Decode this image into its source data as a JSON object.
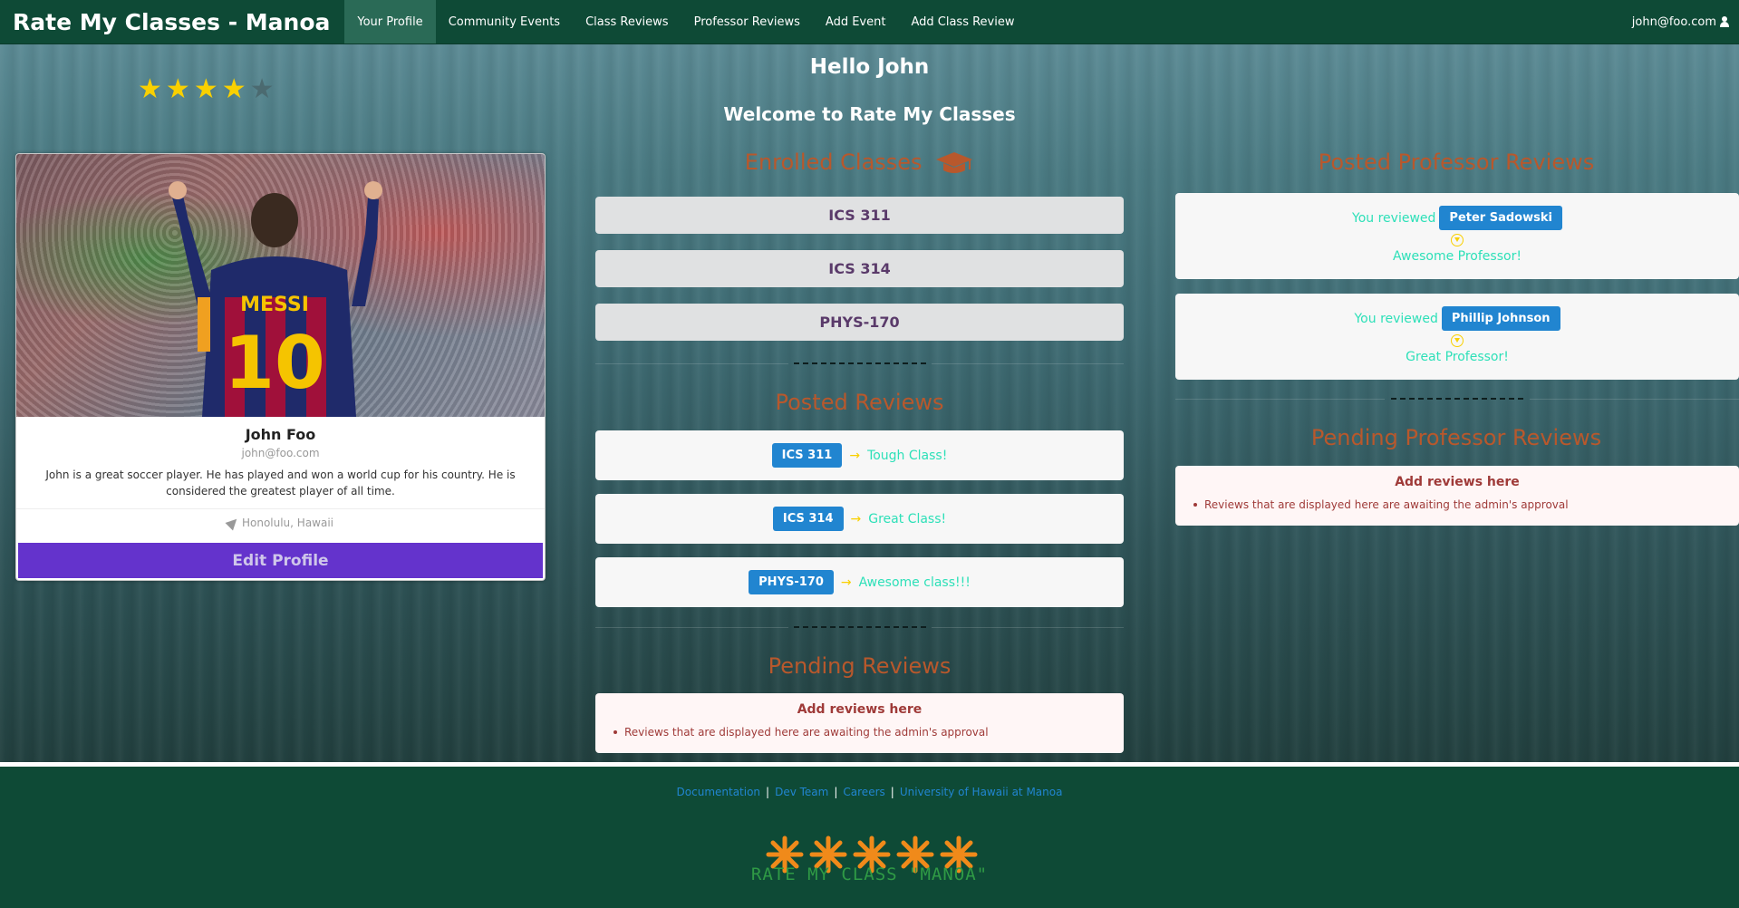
{
  "navbar": {
    "brand": "Rate My Classes - Manoa",
    "items": [
      {
        "label": "Your Profile",
        "active": true
      },
      {
        "label": "Community Events",
        "active": false
      },
      {
        "label": "Class Reviews",
        "active": false
      },
      {
        "label": "Professor Reviews",
        "active": false
      },
      {
        "label": "Add Event",
        "active": false
      },
      {
        "label": "Add Class Review",
        "active": false
      }
    ],
    "user_email": "john@foo.com"
  },
  "header": {
    "hello": "Hello John",
    "welcome": "Welcome to Rate My Classes"
  },
  "profile": {
    "rating": 4,
    "rating_max": 5,
    "name": "John Foo",
    "email": "john@foo.com",
    "description": "John is a great soccer player. He has played and won a world cup for his country. He is considered the greatest player of all time.",
    "location": "Honolulu, Hawaii",
    "edit_button": "Edit Profile",
    "image_jersey_name": "MESSI",
    "image_jersey_number": "10"
  },
  "enrolled": {
    "title": "Enrolled Classes",
    "classes": [
      "ICS 311",
      "ICS 314",
      "PHYS-170"
    ]
  },
  "posted_reviews": {
    "title": "Posted Reviews",
    "items": [
      {
        "class": "ICS 311",
        "text": "Tough Class!"
      },
      {
        "class": "ICS 314",
        "text": "Great Class!"
      },
      {
        "class": "PHYS-170",
        "text": "Awesome class!!!"
      }
    ]
  },
  "pending_reviews": {
    "title": "Pending Reviews",
    "header": "Add reviews here",
    "note": "Reviews that are displayed here are awaiting the admin's approval"
  },
  "professor_reviews": {
    "title": "Posted Professor Reviews",
    "prefix": "You reviewed",
    "items": [
      {
        "professor": "Peter Sadowski",
        "text": "Awesome Professor!"
      },
      {
        "professor": "Phillip Johnson",
        "text": "Great Professor!"
      }
    ]
  },
  "pending_professor_reviews": {
    "title": "Pending Professor Reviews",
    "header": "Add reviews here",
    "note": "Reviews that are displayed here are awaiting the admin's approval"
  },
  "footer": {
    "links": [
      "Documentation",
      "Dev Team",
      "Careers",
      "University of Hawaii at Manoa"
    ],
    "logo_text": "RATE MY CLASS \"MANOA\""
  },
  "colors": {
    "navbar": "#0e4a36",
    "accent_orange": "#b8582c",
    "tag_blue": "#2185d0",
    "review_teal": "#2de0b8",
    "edit_purple": "#6433cc",
    "star_yellow": "#f9d000"
  }
}
